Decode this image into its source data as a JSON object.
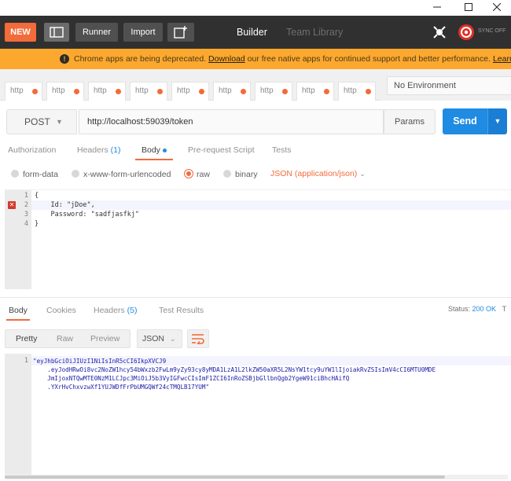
{
  "window": {
    "minimize": "—",
    "maximize": "☐",
    "close": "✕"
  },
  "header": {
    "new_label": "NEW",
    "runner_label": "Runner",
    "import_label": "Import",
    "tabs": [
      {
        "label": "Builder"
      },
      {
        "label": "Team Library"
      }
    ],
    "sync_label": "SYNC OFF"
  },
  "banner": {
    "prefix": "Chrome apps are being deprecated.",
    "download_link": "Download",
    "middle": "our free native apps for continued support and better performance.",
    "learn_more": "Learn more"
  },
  "request_tabs": [
    {
      "label": "http"
    },
    {
      "label": "http"
    },
    {
      "label": "http"
    },
    {
      "label": "http"
    },
    {
      "label": "http"
    },
    {
      "label": "http"
    },
    {
      "label": "http"
    },
    {
      "label": "http"
    },
    {
      "label": "http"
    }
  ],
  "environment": {
    "selected": "No Environment"
  },
  "request": {
    "method": "POST",
    "url": "http://localhost:59039/token",
    "params_label": "Params",
    "send_label": "Send"
  },
  "request_sections": {
    "authorization": "Authorization",
    "headers": "Headers",
    "headers_count": "(1)",
    "body": "Body",
    "pre_request": "Pre-request Script",
    "tests": "Tests"
  },
  "body_types": {
    "form_data": "form-data",
    "urlencoded": "x-www-form-urlencoded",
    "raw": "raw",
    "binary": "binary",
    "content_type": "JSON (application/json)"
  },
  "editor": {
    "line_numbers": [
      "1",
      "2",
      "3",
      "4"
    ],
    "lines": [
      "{",
      "    Id: \"jDoe\",",
      "    Password: \"sadfjasfkj\"",
      "}"
    ]
  },
  "response": {
    "tabs": {
      "body": "Body",
      "cookies": "Cookies",
      "headers": "Headers",
      "headers_count": "(5)",
      "test_results": "Test Results"
    },
    "status_label": "Status:",
    "status_value": "200 OK",
    "time_label": "T",
    "view_modes": [
      "Pretty",
      "Raw",
      "Preview"
    ],
    "format": "JSON",
    "line_numbers": [
      "1"
    ],
    "body_lines": [
      "\"eyJhbGciOiJIUzI1NiIsInR5cCI6IkpXVCJ9",
      "    .eyJodHRwOi8vc2NoZW1hcy54bWxzb2FwLm9yZy93cy8yMDA1LzA1L2lkZW50aXR5L2NsYW1tcy9uYW1lIjoiakRvZSIsImV4cCI6MTU0MDE",
      "    JmIjoxNTQwMTE0NzM1LCJpc3MiOiJ5b3VyIGFwcCIsImF1ZCI6InRoZSBjbGllbnQgb2YgeW91ciBhcHAifQ",
      "    .YXrHvChxvzwXf1YUJWDfFrPbUMGQWf24cTMQLB17YUM\""
    ]
  }
}
